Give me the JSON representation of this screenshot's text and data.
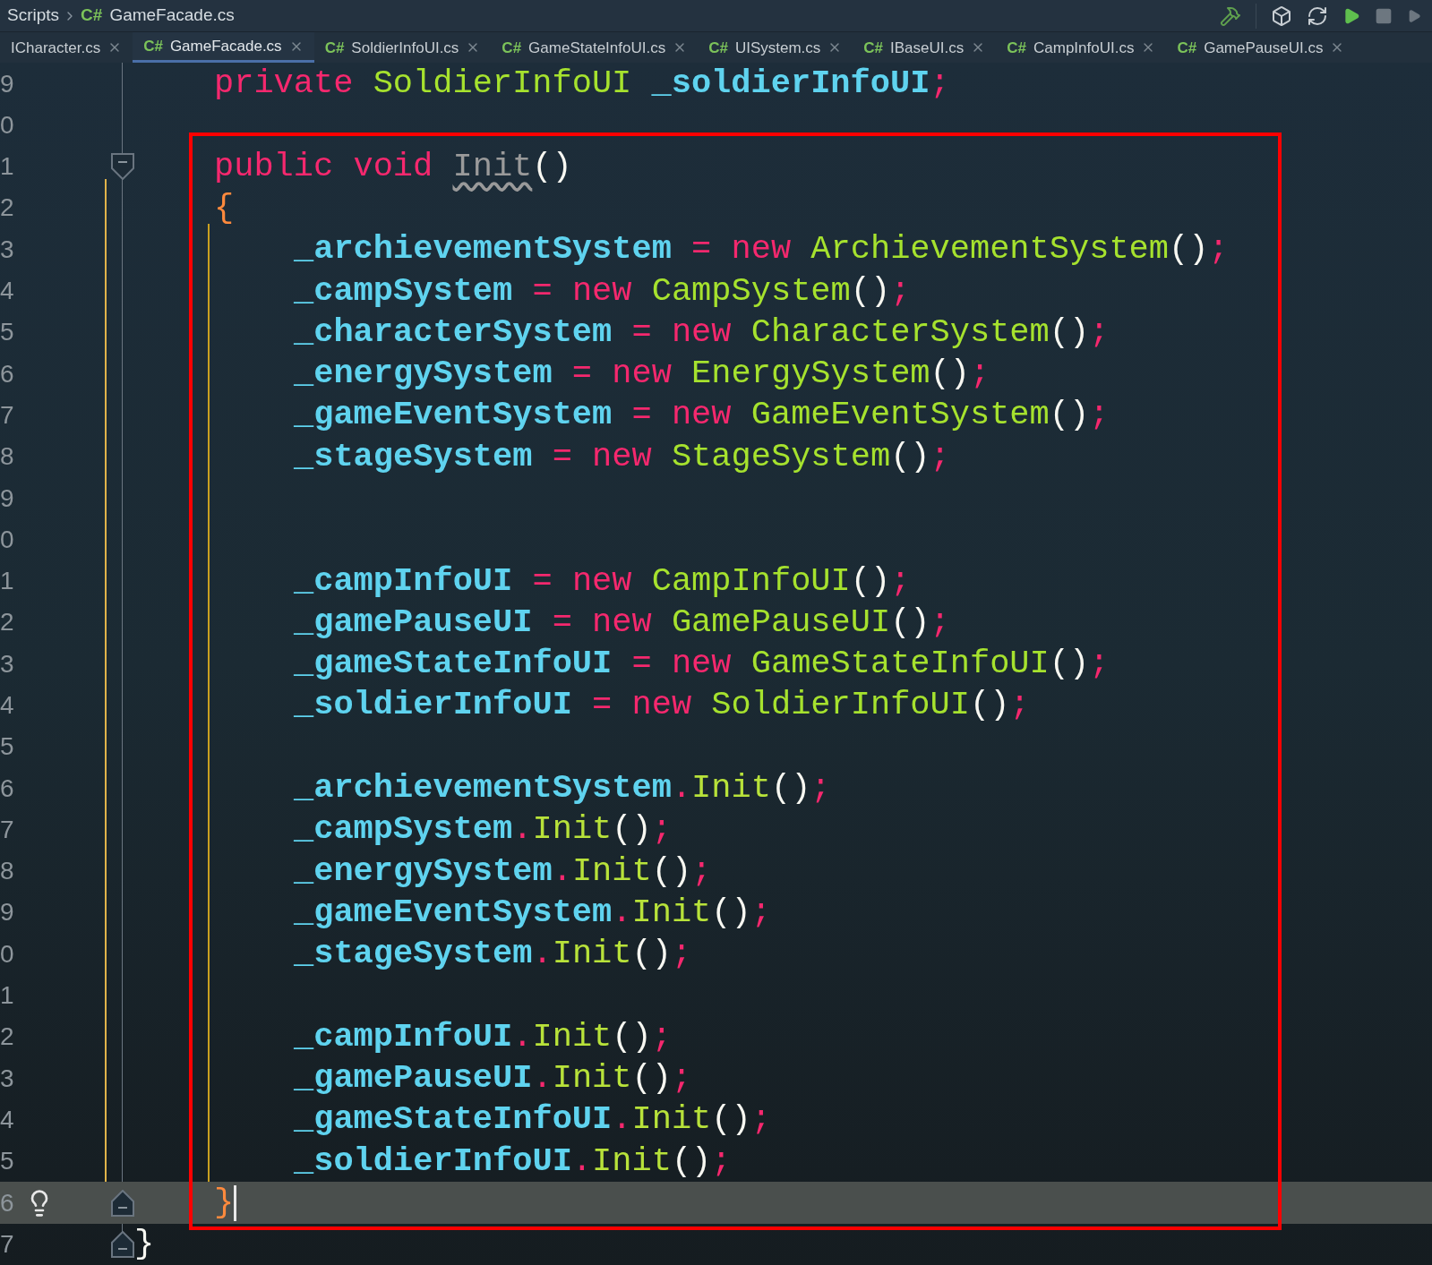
{
  "breadcrumb": [
    {
      "label": "Scripts"
    },
    {
      "badge": "C#",
      "label": "GameFacade.cs"
    }
  ],
  "tabs": [
    {
      "label": "ICharacter.cs",
      "selected": false
    },
    {
      "badge": "C#",
      "label": "GameFacade.cs",
      "selected": true
    },
    {
      "badge": "C#",
      "label": "SoldierInfoUI.cs",
      "selected": false
    },
    {
      "badge": "C#",
      "label": "GameStateInfoUI.cs",
      "selected": false
    },
    {
      "badge": "C#",
      "label": "UISystem.cs",
      "selected": false
    },
    {
      "badge": "C#",
      "label": "IBaseUI.cs",
      "selected": false
    },
    {
      "badge": "C#",
      "label": "CampInfoUI.cs",
      "selected": false
    },
    {
      "badge": "C#",
      "label": "GamePauseUI.cs",
      "selected": false
    }
  ],
  "editor": {
    "lines": [
      {
        "number": "9",
        "kind": "member",
        "tokens": [
          {
            "text": "private ",
            "kind": "keyword"
          },
          {
            "text": "SoldierInfoUI ",
            "kind": "type"
          },
          {
            "text": "_soldierInfoUI",
            "kind": "field"
          },
          {
            "text": ";",
            "kind": "op"
          }
        ]
      },
      {
        "number": "0"
      },
      {
        "number": "1",
        "kind": "member",
        "fold_start": true,
        "tokens": [
          {
            "text": "public ",
            "kind": "keyword"
          },
          {
            "text": "void ",
            "kind": "keyword"
          },
          {
            "text": "Init",
            "kind": "unused"
          },
          {
            "text": "()",
            "kind": "paren"
          }
        ]
      },
      {
        "number": "2",
        "kind": "member",
        "tokens": [
          {
            "text": "{",
            "kind": "match"
          }
        ]
      },
      {
        "number": "3",
        "kind": "body",
        "tokens": [
          {
            "text": "_archievementSystem",
            "kind": "field"
          },
          {
            "text": " = ",
            "kind": "op"
          },
          {
            "text": "new ",
            "kind": "keyword"
          },
          {
            "text": "ArchievementSystem",
            "kind": "type"
          },
          {
            "text": "()",
            "kind": "paren"
          },
          {
            "text": ";",
            "kind": "op"
          }
        ]
      },
      {
        "number": "4",
        "kind": "body",
        "tokens": [
          {
            "text": "_campSystem",
            "kind": "field"
          },
          {
            "text": " = ",
            "kind": "op"
          },
          {
            "text": "new ",
            "kind": "keyword"
          },
          {
            "text": "CampSystem",
            "kind": "type"
          },
          {
            "text": "()",
            "kind": "paren"
          },
          {
            "text": ";",
            "kind": "op"
          }
        ]
      },
      {
        "number": "5",
        "kind": "body",
        "tokens": [
          {
            "text": "_characterSystem",
            "kind": "field"
          },
          {
            "text": " = ",
            "kind": "op"
          },
          {
            "text": "new ",
            "kind": "keyword"
          },
          {
            "text": "CharacterSystem",
            "kind": "type"
          },
          {
            "text": "()",
            "kind": "paren"
          },
          {
            "text": ";",
            "kind": "op"
          }
        ]
      },
      {
        "number": "6",
        "kind": "body",
        "tokens": [
          {
            "text": "_energySystem",
            "kind": "field"
          },
          {
            "text": " = ",
            "kind": "op"
          },
          {
            "text": "new ",
            "kind": "keyword"
          },
          {
            "text": "EnergySystem",
            "kind": "type"
          },
          {
            "text": "()",
            "kind": "paren"
          },
          {
            "text": ";",
            "kind": "op"
          }
        ]
      },
      {
        "number": "7",
        "kind": "body",
        "tokens": [
          {
            "text": "_gameEventSystem",
            "kind": "field"
          },
          {
            "text": " = ",
            "kind": "op"
          },
          {
            "text": "new ",
            "kind": "keyword"
          },
          {
            "text": "GameEventSystem",
            "kind": "type"
          },
          {
            "text": "()",
            "kind": "paren"
          },
          {
            "text": ";",
            "kind": "op"
          }
        ]
      },
      {
        "number": "8",
        "kind": "body",
        "tokens": [
          {
            "text": "_stageSystem",
            "kind": "field"
          },
          {
            "text": " = ",
            "kind": "op"
          },
          {
            "text": "new ",
            "kind": "keyword"
          },
          {
            "text": "StageSystem",
            "kind": "type"
          },
          {
            "text": "()",
            "kind": "paren"
          },
          {
            "text": ";",
            "kind": "op"
          }
        ]
      },
      {
        "number": "9"
      },
      {
        "number": "0"
      },
      {
        "number": "1",
        "kind": "body",
        "tokens": [
          {
            "text": "_campInfoUI",
            "kind": "field"
          },
          {
            "text": " = ",
            "kind": "op"
          },
          {
            "text": "new ",
            "kind": "keyword"
          },
          {
            "text": "CampInfoUI",
            "kind": "type"
          },
          {
            "text": "()",
            "kind": "paren"
          },
          {
            "text": ";",
            "kind": "op"
          }
        ]
      },
      {
        "number": "2",
        "kind": "body",
        "tokens": [
          {
            "text": "_gamePauseUI",
            "kind": "field"
          },
          {
            "text": " = ",
            "kind": "op"
          },
          {
            "text": "new ",
            "kind": "keyword"
          },
          {
            "text": "GamePauseUI",
            "kind": "type"
          },
          {
            "text": "()",
            "kind": "paren"
          },
          {
            "text": ";",
            "kind": "op"
          }
        ]
      },
      {
        "number": "3",
        "kind": "body",
        "tokens": [
          {
            "text": "_gameStateInfoUI",
            "kind": "field"
          },
          {
            "text": " = ",
            "kind": "op"
          },
          {
            "text": "new ",
            "kind": "keyword"
          },
          {
            "text": "GameStateInfoUI",
            "kind": "type"
          },
          {
            "text": "()",
            "kind": "paren"
          },
          {
            "text": ";",
            "kind": "op"
          }
        ]
      },
      {
        "number": "4",
        "kind": "body",
        "tokens": [
          {
            "text": "_soldierInfoUI",
            "kind": "field"
          },
          {
            "text": " = ",
            "kind": "op"
          },
          {
            "text": "new ",
            "kind": "keyword"
          },
          {
            "text": "SoldierInfoUI",
            "kind": "type"
          },
          {
            "text": "()",
            "kind": "paren"
          },
          {
            "text": ";",
            "kind": "op"
          }
        ]
      },
      {
        "number": "5"
      },
      {
        "number": "6",
        "kind": "body",
        "tokens": [
          {
            "text": "_archievementSystem",
            "kind": "field"
          },
          {
            "text": ".",
            "kind": "op"
          },
          {
            "text": "Init",
            "kind": "method"
          },
          {
            "text": "()",
            "kind": "paren"
          },
          {
            "text": ";",
            "kind": "op"
          }
        ]
      },
      {
        "number": "7",
        "kind": "body",
        "tokens": [
          {
            "text": "_campSystem",
            "kind": "field"
          },
          {
            "text": ".",
            "kind": "op"
          },
          {
            "text": "Init",
            "kind": "method"
          },
          {
            "text": "()",
            "kind": "paren"
          },
          {
            "text": ";",
            "kind": "op"
          }
        ]
      },
      {
        "number": "8",
        "kind": "body",
        "tokens": [
          {
            "text": "_energySystem",
            "kind": "field"
          },
          {
            "text": ".",
            "kind": "op"
          },
          {
            "text": "Init",
            "kind": "method"
          },
          {
            "text": "()",
            "kind": "paren"
          },
          {
            "text": ";",
            "kind": "op"
          }
        ]
      },
      {
        "number": "9",
        "kind": "body",
        "tokens": [
          {
            "text": "_gameEventSystem",
            "kind": "field"
          },
          {
            "text": ".",
            "kind": "op"
          },
          {
            "text": "Init",
            "kind": "method"
          },
          {
            "text": "()",
            "kind": "paren"
          },
          {
            "text": ";",
            "kind": "op"
          }
        ]
      },
      {
        "number": "0",
        "kind": "body",
        "tokens": [
          {
            "text": "_stageSystem",
            "kind": "field"
          },
          {
            "text": ".",
            "kind": "op"
          },
          {
            "text": "Init",
            "kind": "method"
          },
          {
            "text": "()",
            "kind": "paren"
          },
          {
            "text": ";",
            "kind": "op"
          }
        ]
      },
      {
        "number": "1"
      },
      {
        "number": "2",
        "kind": "body",
        "tokens": [
          {
            "text": "_campInfoUI",
            "kind": "field"
          },
          {
            "text": ".",
            "kind": "op"
          },
          {
            "text": "Init",
            "kind": "method"
          },
          {
            "text": "()",
            "kind": "paren"
          },
          {
            "text": ";",
            "kind": "op"
          }
        ]
      },
      {
        "number": "3",
        "kind": "body",
        "tokens": [
          {
            "text": "_gamePauseUI",
            "kind": "field"
          },
          {
            "text": ".",
            "kind": "op"
          },
          {
            "text": "Init",
            "kind": "method"
          },
          {
            "text": "()",
            "kind": "paren"
          },
          {
            "text": ";",
            "kind": "op"
          }
        ]
      },
      {
        "number": "4",
        "kind": "body",
        "tokens": [
          {
            "text": "_gameStateInfoUI",
            "kind": "field"
          },
          {
            "text": ".",
            "kind": "op"
          },
          {
            "text": "Init",
            "kind": "method"
          },
          {
            "text": "()",
            "kind": "paren"
          },
          {
            "text": ";",
            "kind": "op"
          }
        ]
      },
      {
        "number": "5",
        "kind": "body",
        "tokens": [
          {
            "text": "_soldierInfoUI",
            "kind": "field"
          },
          {
            "text": ".",
            "kind": "op"
          },
          {
            "text": "Init",
            "kind": "method"
          },
          {
            "text": "()",
            "kind": "paren"
          },
          {
            "text": ";",
            "kind": "op"
          }
        ]
      },
      {
        "number": "6",
        "kind": "member",
        "fold_end": true,
        "bulb": true,
        "current": true,
        "tokens": [
          {
            "text": "}",
            "kind": "match"
          }
        ]
      },
      {
        "number": "7",
        "kind": "outer",
        "fold_end": true,
        "tokens": [
          {
            "text": "}",
            "kind": "plain"
          }
        ]
      }
    ]
  }
}
